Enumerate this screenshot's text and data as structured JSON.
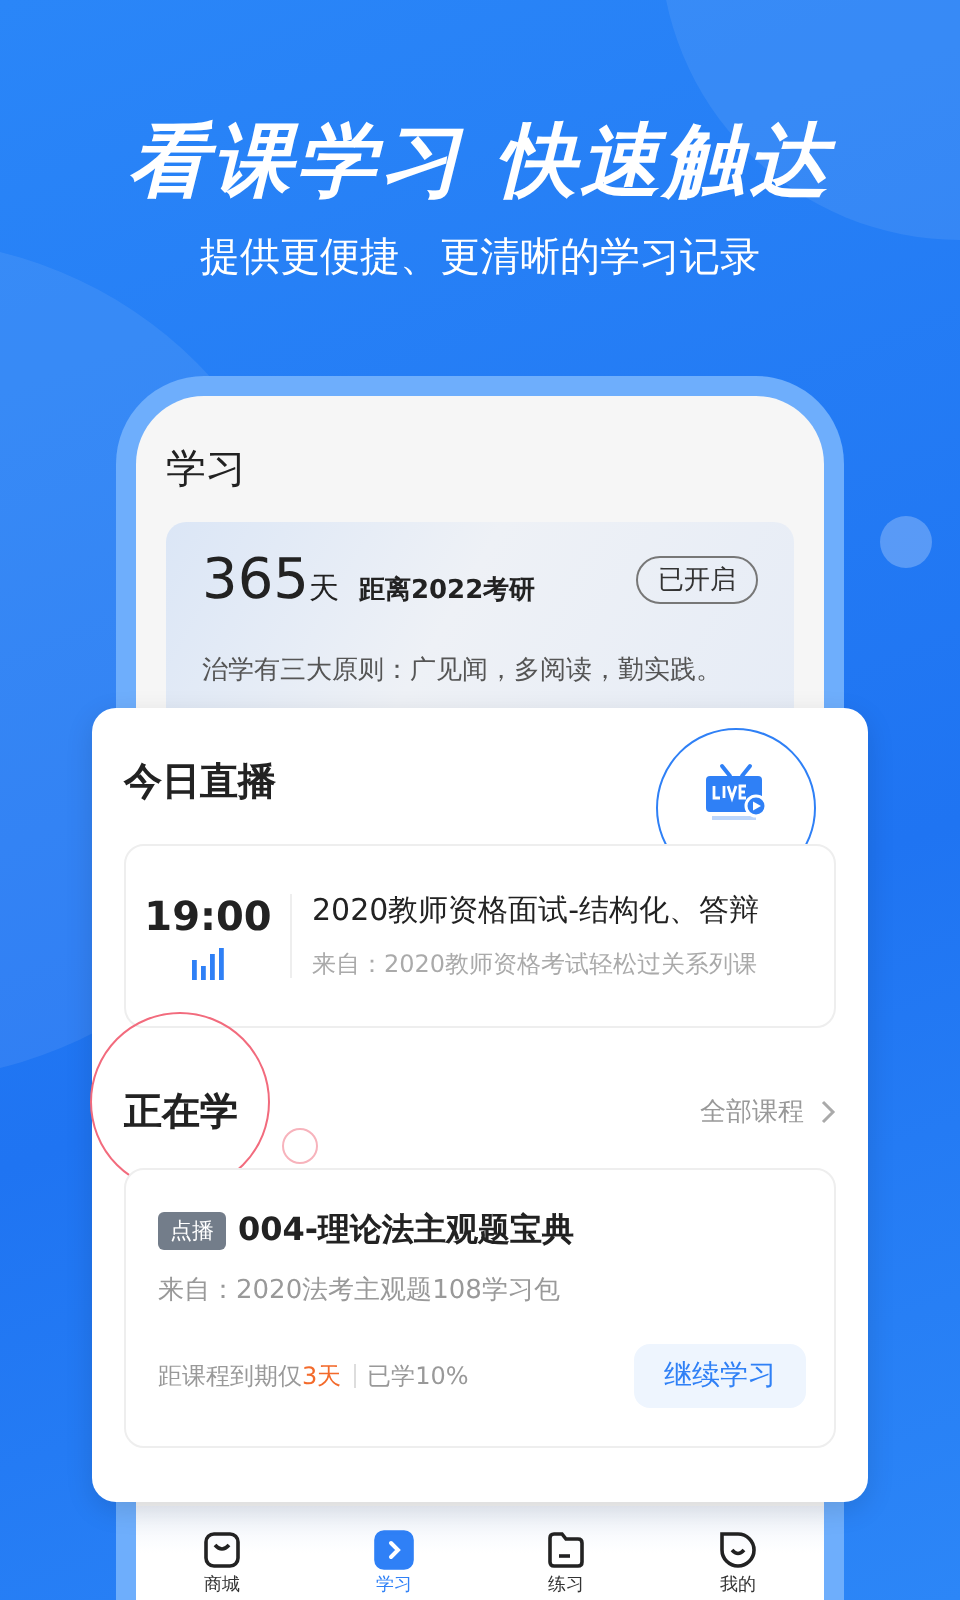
{
  "headline": "看课学习 快速触达",
  "subheadline": "提供更便捷、更清晰的学习记录",
  "screen": {
    "title": "学习",
    "goal": {
      "days": "365",
      "unit": "天",
      "target": "距离2022考研",
      "status": "已开启",
      "motto": "治学有三大原则：广见闻，多阅读，勤实践。"
    }
  },
  "live": {
    "title": "今日直播",
    "sessions": [
      {
        "time": "19:00",
        "title": "2020教师资格面试-结构化、答辩",
        "source": "来自：2020教师资格考试轻松过关系列课"
      }
    ]
  },
  "learning": {
    "title": "正在学",
    "all_link": "全部课程",
    "courses": [
      {
        "tag": "点播",
        "title": "004-理论法主观题宝典",
        "source": "来自：2020法考主观题108学习包",
        "expiry_prefix": "距课程到期仅",
        "expiry_days": "3天",
        "progress": "已学10%",
        "button": "继续学习"
      }
    ]
  },
  "tab_bar": [
    {
      "kind": "shop",
      "label": "商城",
      "selected": false
    },
    {
      "kind": "study",
      "label": "学习",
      "selected": true
    },
    {
      "kind": "practice",
      "label": "练习",
      "selected": false
    },
    {
      "kind": "profile",
      "label": "我的",
      "selected": false
    }
  ]
}
